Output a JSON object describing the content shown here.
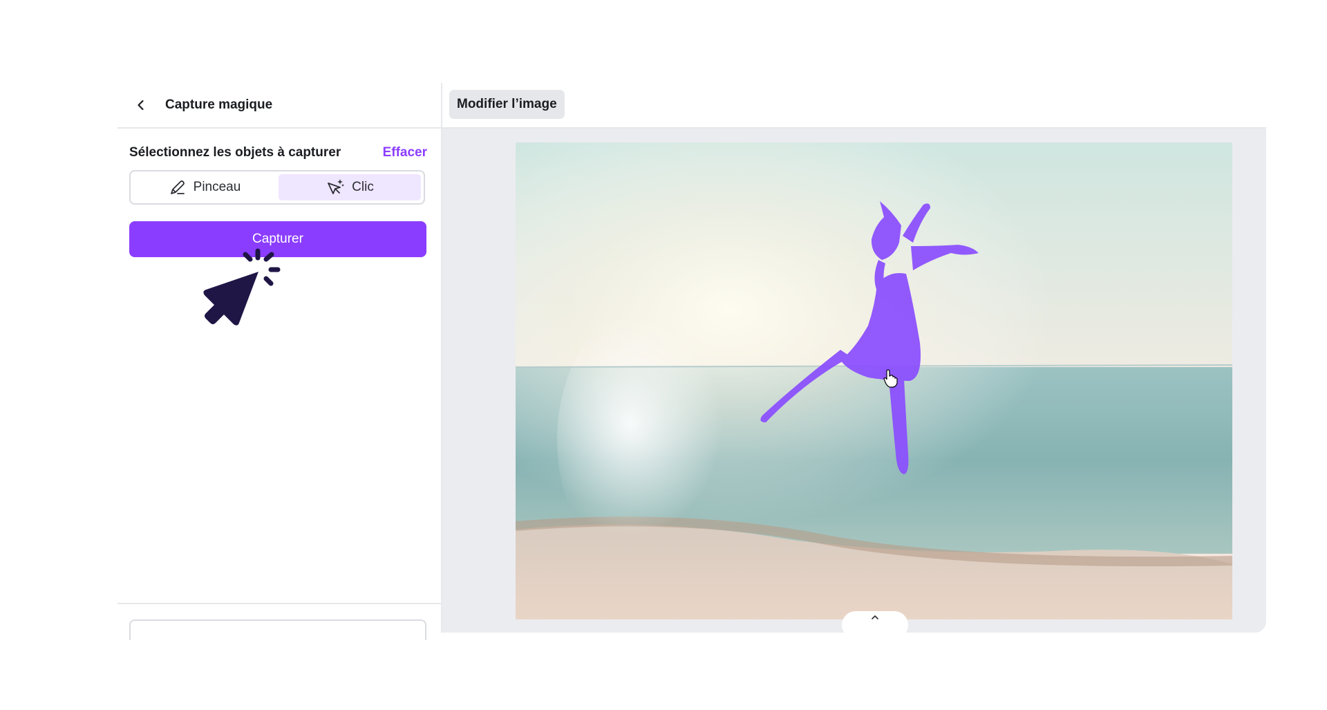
{
  "panel": {
    "title": "Capture magique",
    "select_label": "Sélectionnez les objets à capturer",
    "clear_label": "Effacer",
    "modes": [
      {
        "label": "Pinceau",
        "icon": "brush-icon",
        "active": false
      },
      {
        "label": "Clic",
        "icon": "click-sparkle-icon",
        "active": true
      }
    ],
    "capture_label": "Capturer"
  },
  "toolbar": {
    "edit_image_label": "Modifier l’image"
  },
  "colors": {
    "accent": "#8b3dff",
    "selection_overlay": "#8a4dff",
    "toggle_active_bg": "#efe6ff",
    "cursor_graphic": "#1f1646"
  },
  "icons": {
    "back": "chevron-left-icon",
    "pointer_overlay": "pointer-click-icon",
    "canvas_cursor": "hand-cursor-icon",
    "collapse": "chevron-up-icon"
  }
}
